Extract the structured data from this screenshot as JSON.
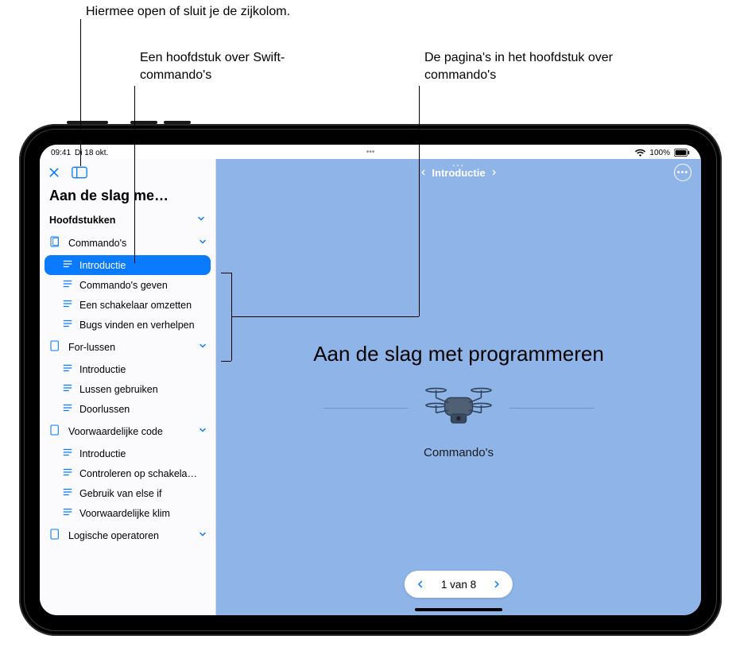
{
  "callouts": {
    "sidebar_toggle": "Hiermee open of sluit je de zijkolom.",
    "chapter": "Een hoofdstuk over Swift-commando's",
    "pages": "De pagina's in het hoofdstuk over commando's"
  },
  "statusbar": {
    "time": "09:41",
    "date": "Di 18 okt.",
    "battery": "100%"
  },
  "sidebar": {
    "title": "Aan de slag me…",
    "section_label": "Hoofdstukken",
    "chapters": [
      {
        "label": "Commando's",
        "pages": [
          "Introductie",
          "Commando's geven",
          "Een schakelaar omzetten",
          "Bugs vinden en verhelpen"
        ],
        "selected_page": 0
      },
      {
        "label": "For-lussen",
        "pages": [
          "Introductie",
          "Lussen gebruiken",
          "Doorlussen"
        ]
      },
      {
        "label": "Voorwaardelijke code",
        "pages": [
          "Introductie",
          "Controleren op schakela…",
          "Gebruik van else if",
          "Voorwaardelijke klim"
        ]
      },
      {
        "label": "Logische operatoren",
        "pages": []
      }
    ]
  },
  "main": {
    "breadcrumb": "Introductie",
    "title": "Aan de slag met programmeren",
    "subtitle": "Commando's",
    "pager": "1 van 8"
  }
}
